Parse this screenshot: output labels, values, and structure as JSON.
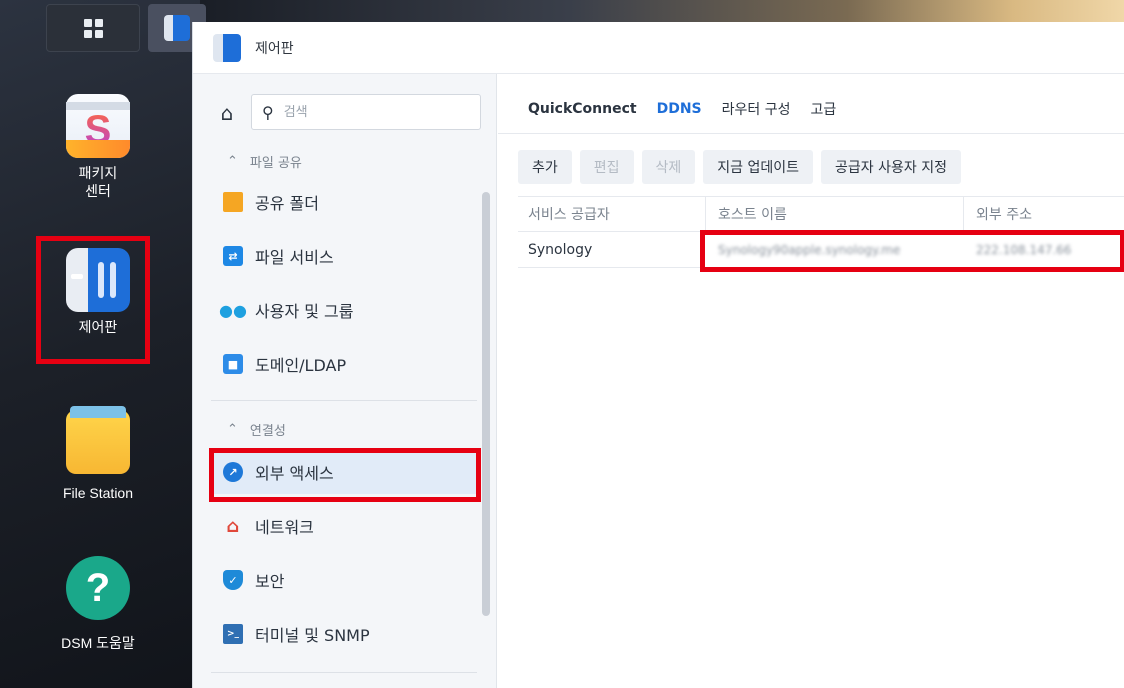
{
  "desktop": {
    "items": [
      {
        "label_line1": "패키지",
        "label_line2": "센터",
        "icon": "package-center-icon"
      },
      {
        "label": "제어판",
        "icon": "control-panel-icon"
      },
      {
        "label": "File Station",
        "icon": "file-station-icon"
      },
      {
        "label": "DSM 도움말",
        "icon": "help-icon"
      }
    ]
  },
  "window": {
    "title": "제어판"
  },
  "sidebar": {
    "search_placeholder": "검색",
    "sections": [
      {
        "header": "파일 공유",
        "items": [
          {
            "label": "공유 폴더",
            "icon": "shared-folder-icon"
          },
          {
            "label": "파일 서비스",
            "icon": "file-services-icon"
          },
          {
            "label": "사용자 및 그룹",
            "icon": "users-group-icon"
          },
          {
            "label": "도메인/LDAP",
            "icon": "domain-ldap-icon"
          }
        ]
      },
      {
        "header": "연결성",
        "items": [
          {
            "label": "외부 액세스",
            "icon": "external-access-icon",
            "active": true
          },
          {
            "label": "네트워크",
            "icon": "network-icon"
          },
          {
            "label": "보안",
            "icon": "security-icon"
          },
          {
            "label": "터미널 및 SNMP",
            "icon": "terminal-icon"
          }
        ]
      }
    ]
  },
  "main": {
    "tabs": [
      {
        "label": "QuickConnect"
      },
      {
        "label": "DDNS",
        "active": true
      },
      {
        "label": "라우터 구성"
      },
      {
        "label": "고급"
      }
    ],
    "toolbar": {
      "add": "추가",
      "edit": "편집",
      "delete": "삭제",
      "update_now": "지금 업데이트",
      "customize_provider": "공급자 사용자 지정"
    },
    "table": {
      "headers": [
        "서비스 공급자",
        "호스트 이름",
        "외부 주소"
      ],
      "rows": [
        {
          "provider": "Synology",
          "hostname": "Synology90apple.synology.me",
          "external_address": "222.108.147.66"
        }
      ]
    }
  },
  "colors": {
    "accent": "#1e6ed8",
    "highlight_box": "#e60012",
    "sidebar_bg": "#f4f6f9",
    "active_item_bg": "#e1ebf8"
  }
}
